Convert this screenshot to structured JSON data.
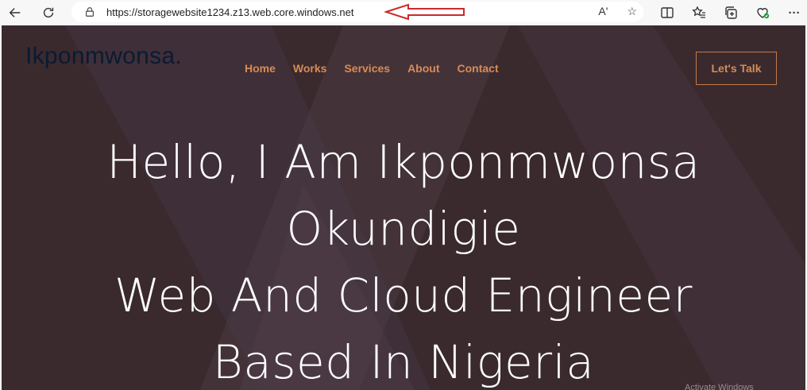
{
  "browser": {
    "url": "https://storagewebsite1234.z13.web.core.windows.net",
    "icons": {
      "back": "arrow-left-icon",
      "refresh": "refresh-icon",
      "lock": "lock-icon",
      "read_aloud": "read-aloud-icon",
      "favorite": "star-icon",
      "split": "split-screen-icon",
      "favorites": "favorites-icon",
      "collections": "collections-icon",
      "performance": "performance-icon",
      "more": "more-icon"
    },
    "read_aloud_glyph": "Aʹ",
    "more_glyph": "···"
  },
  "annotation": {
    "arrow_color": "#cc2a2a"
  },
  "site": {
    "logo": "Ikponmwonsa.",
    "nav": [
      "Home",
      "Works",
      "Services",
      "About",
      "Contact"
    ],
    "cta": "Let's Talk",
    "hero_lines": [
      "Hello, I Am Ikponmwonsa",
      "Okundigie",
      "Web And Cloud Engineer",
      "Based In Nigeria"
    ],
    "colors": {
      "background": "#3a2a2e",
      "accent": "#d88b55",
      "logo": "#0b1a33",
      "hero_text": "#ffffff"
    }
  },
  "os_watermark": "Activate Windows"
}
